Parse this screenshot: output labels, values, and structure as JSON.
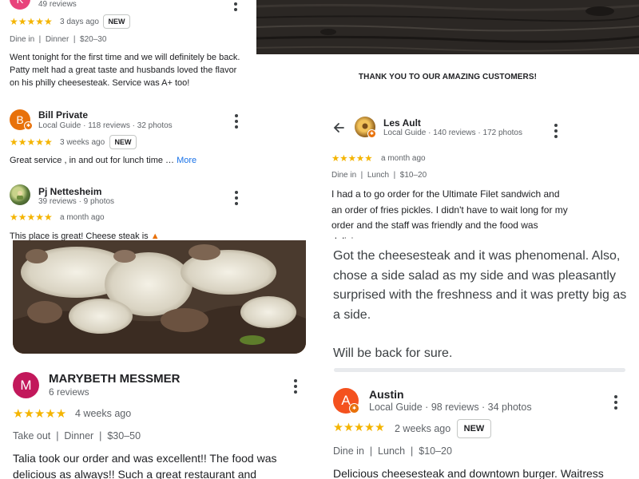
{
  "top_left": {
    "avatar_letter": "K",
    "avatar_color": "#e8437b",
    "reviews_count": "49 reviews",
    "stars": "★★★★★",
    "time": "3 days ago",
    "badge": "NEW",
    "chips": "Dine in  |  Dinner  |  $20–30",
    "text": "Went tonight for the first time and we will definitely be back. Patty melt had a great taste and husbands loved the flavor on his philly cheesesteak. Service was A+ too!"
  },
  "bill": {
    "avatar_letter": "B",
    "avatar_color": "#e8710a",
    "name": "Bill Private",
    "meta": "Local Guide · 118 reviews · 32 photos",
    "stars": "★★★★★",
    "time": "3 weeks ago",
    "badge": "NEW",
    "text": "Great service , in and out for lunch time … ",
    "more": "More"
  },
  "pj": {
    "name": "Pj Nettesheim",
    "meta": "39 reviews · 9 photos",
    "stars": "★★★★★",
    "time": "a month ago",
    "text": "This place is great! Cheese steak is "
  },
  "marybeth": {
    "avatar_letter": "M",
    "avatar_color": "#c2185b",
    "name": "MARYBETH MESSMER",
    "meta": "6 reviews",
    "stars": "★★★★★",
    "time": "4 weeks ago",
    "chips": "Take out  |  Dinner  |  $30–50",
    "text": "Talia took our order and was excellent!! The food was delicious as always!! Such a great restaurant and"
  },
  "banner": {
    "thanks": "THANK YOU TO OUR AMAZING CUSTOMERS!"
  },
  "les": {
    "name": "Les Ault",
    "meta": "Local Guide · 140 reviews · 172 photos",
    "stars": "★★★★★",
    "time": "a month ago",
    "chips": "Dine in  |  Lunch  |  $10–20",
    "text": "I had a to go order for the Ultimate Filet sandwich and an order of fries pickles. I didn't have to wait long for my order and the staff was friendly and the food was delicious."
  },
  "cheesesteak_review": {
    "text_1": "Got the cheesesteak and it was phenomenal. Also, chose a side salad as my side and was pleasantly surprised with the freshness and it was pretty big as a side.",
    "text_2": "Will be back for sure."
  },
  "austin": {
    "avatar_letter": "A",
    "avatar_color": "#f4511e",
    "name": "Austin",
    "meta": "Local Guide · 98 reviews · 34 photos",
    "stars": "★★★★★",
    "time": "2 weeks ago",
    "badge": "NEW",
    "chips": "Dine in  |  Lunch  |  $10–20",
    "text": "Delicious cheesesteak and downtown burger. Waitress"
  },
  "colors": {
    "star": "#f4b400",
    "link": "#1a73e8",
    "guide_badge": "#e8710a"
  }
}
